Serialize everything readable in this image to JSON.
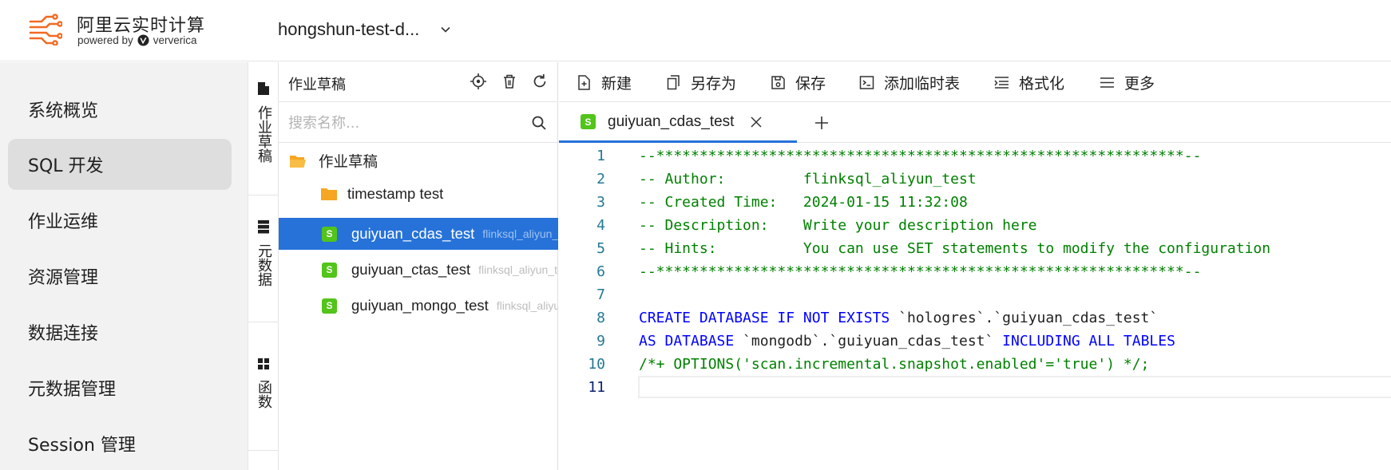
{
  "header": {
    "brand_title": "阿里云实时计算",
    "brand_powered": "powered by",
    "brand_vendor": "ververica",
    "workspace": "hongshun-test-d..."
  },
  "nav": {
    "items": [
      {
        "label": "系统概览",
        "active": false
      },
      {
        "label": "SQL 开发",
        "active": true
      },
      {
        "label": "作业运维",
        "active": false
      },
      {
        "label": "资源管理",
        "active": false
      },
      {
        "label": "数据连接",
        "active": false
      },
      {
        "label": "元数据管理",
        "active": false
      },
      {
        "label": "Session 管理",
        "active": false
      }
    ]
  },
  "vtabs": [
    {
      "label": "作业草稿",
      "icon": "file-icon"
    },
    {
      "label": "元数据",
      "icon": "database-icon"
    },
    {
      "label": "函数",
      "icon": "grid-icon"
    }
  ],
  "drafts": {
    "title": "作业草稿",
    "search_placeholder": "搜索名称...",
    "root_folder": "作业草稿",
    "subfolder": "timestamp test",
    "files": [
      {
        "name": "guiyuan_cdas_test",
        "owner": "flinksql_aliyun_test",
        "selected": true
      },
      {
        "name": "guiyuan_ctas_test",
        "owner": "flinksql_aliyun_test",
        "selected": false
      },
      {
        "name": "guiyuan_mongo_test",
        "owner": "flinksql_aliyun_test",
        "selected": false
      }
    ]
  },
  "toolbar": {
    "new": "新建",
    "save_as": "另存为",
    "save": "保存",
    "add_temp_table": "添加临时表",
    "format": "格式化",
    "more": "更多"
  },
  "editor_tab": {
    "badge": "S",
    "name": "guiyuan_cdas_test"
  },
  "code": [
    {
      "n": "1",
      "parts": [
        {
          "t": "--*************************************************************--",
          "c": "comment"
        }
      ]
    },
    {
      "n": "2",
      "parts": [
        {
          "t": "-- Author:         flinksql_aliyun_test",
          "c": "comment"
        }
      ]
    },
    {
      "n": "3",
      "parts": [
        {
          "t": "-- Created Time:   2024-01-15 11:32:08",
          "c": "comment"
        }
      ]
    },
    {
      "n": "4",
      "parts": [
        {
          "t": "-- Description:    Write your description here",
          "c": "comment"
        }
      ]
    },
    {
      "n": "5",
      "parts": [
        {
          "t": "-- Hints:          You can use SET statements to modify the configuration",
          "c": "comment"
        }
      ]
    },
    {
      "n": "6",
      "parts": [
        {
          "t": "--*************************************************************--",
          "c": "comment"
        }
      ]
    },
    {
      "n": "7",
      "parts": []
    },
    {
      "n": "8",
      "parts": [
        {
          "t": "CREATE DATABASE IF NOT EXISTS",
          "c": "kw"
        },
        {
          "t": " `hologres`.`guiyuan_cdas_test`",
          "c": "plain"
        }
      ]
    },
    {
      "n": "9",
      "parts": [
        {
          "t": "AS DATABASE",
          "c": "kw"
        },
        {
          "t": " `mongodb`.`guiyuan_cdas_test` ",
          "c": "plain"
        },
        {
          "t": "INCLUDING ALL TABLES",
          "c": "kw"
        }
      ]
    },
    {
      "n": "10",
      "parts": [
        {
          "t": "/*+ OPTIONS('scan.incremental.snapshot.enabled'='true') */;",
          "c": "comment"
        }
      ]
    },
    {
      "n": "11",
      "parts": []
    }
  ]
}
